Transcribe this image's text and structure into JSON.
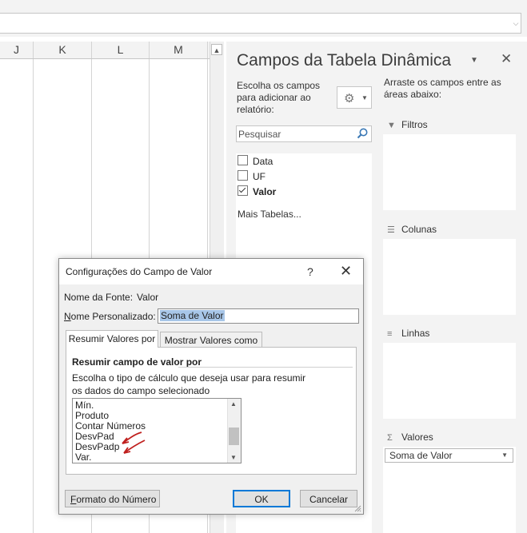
{
  "formula_bar": {
    "dropdown_icon": "chevron-down-icon"
  },
  "grid": {
    "columns": [
      "J",
      "K",
      "L",
      "M"
    ]
  },
  "pivot_pane": {
    "title": "Campos da Tabela Dinâmica",
    "choose_fields_text": "Escolha os campos para adicionar ao relatório:",
    "search_placeholder": "Pesquisar",
    "fields": [
      {
        "label": "Data",
        "checked": false
      },
      {
        "label": "UF",
        "checked": false
      },
      {
        "label": "Valor",
        "checked": true
      }
    ],
    "more_tables": "Mais Tabelas...",
    "drag_text": "Arraste os campos entre as áreas abaixo:",
    "areas": {
      "filters": "Filtros",
      "columns": "Colunas",
      "rows": "Linhas",
      "values": "Valores"
    },
    "value_chip": "Soma de Valor"
  },
  "dialog": {
    "title": "Configurações do Campo de Valor",
    "help": "?",
    "source_label": "Nome da Fonte:",
    "source_value": "Valor",
    "custom_name_label_u": "N",
    "custom_name_label_rest": "ome Personalizado:",
    "custom_name_value": "Soma de Valor",
    "tabs": [
      "Resumir Valores por",
      "Mostrar Valores como"
    ],
    "section_head": "Resumir campo de valor por",
    "instr_line1": "Escolha o tipo de cálculo que deseja usar para resumir",
    "instr_line2": "os dados do campo selecionado",
    "functions": [
      "Mín.",
      "Produto",
      "Contar Números",
      "DesvPad",
      "DesvPadp",
      "Var."
    ],
    "format_button_u": "F",
    "format_button_rest": "ormato do Número",
    "ok_button": "OK",
    "cancel_button": "Cancelar"
  },
  "colors": {
    "accent": "#0078d7",
    "selection": "#a8c6e8",
    "annotation": "#c0201e"
  }
}
